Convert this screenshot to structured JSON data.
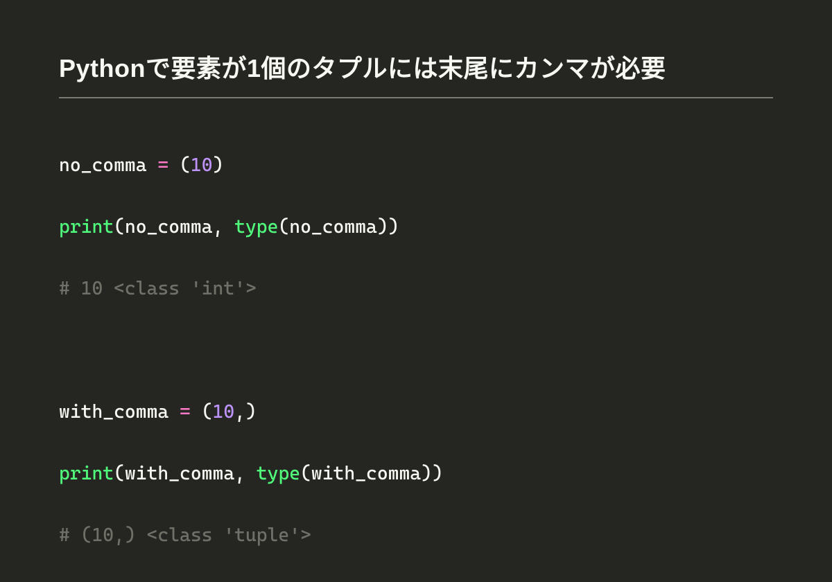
{
  "title": "Pythonで要素が1個のタプルには末尾にカンマが必要",
  "code": {
    "l1": {
      "var": "no_comma",
      "sp1": " ",
      "op": "=",
      "sp2": " ",
      "lp": "(",
      "num": "10",
      "rp": ")"
    },
    "l2": {
      "fn1": "print",
      "lp1": "(",
      "arg1": "no_comma",
      "comma": ",",
      "sp": " ",
      "fn2": "type",
      "lp2": "(",
      "arg2": "no_comma",
      "rp2": ")",
      "rp1": ")"
    },
    "l3": {
      "comment": "# 10 <class 'int'>"
    },
    "l5": {
      "var": "with_comma",
      "sp1": " ",
      "op": "=",
      "sp2": " ",
      "lp": "(",
      "num": "10",
      "comma": ",",
      "rp": ")"
    },
    "l6": {
      "fn1": "print",
      "lp1": "(",
      "arg1": "with_comma",
      "comma": ",",
      "sp": " ",
      "fn2": "type",
      "lp2": "(",
      "arg2": "with_comma",
      "rp2": ")",
      "rp1": ")"
    },
    "l7": {
      "comment": "# (10,) <class 'tuple'>"
    }
  }
}
